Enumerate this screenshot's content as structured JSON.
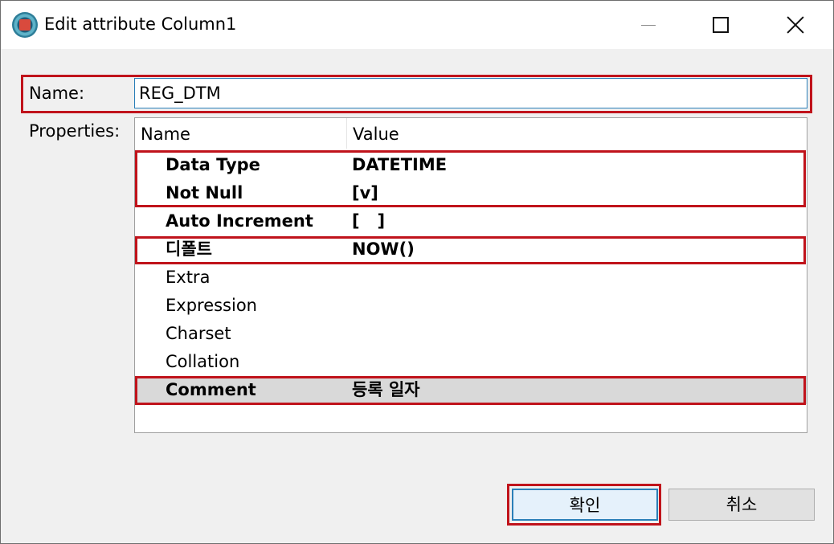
{
  "window": {
    "title": "Edit attribute Column1"
  },
  "form": {
    "name_label": "Name:",
    "name_value": "REG_DTM",
    "properties_label": "Properties:"
  },
  "table": {
    "headers": [
      "Name",
      "Value"
    ],
    "rows": [
      {
        "name": "Data Type",
        "value": "DATETIME"
      },
      {
        "name": "Not Null",
        "value": "[v]"
      },
      {
        "name": "Auto Increment",
        "value": "[   ]"
      },
      {
        "name": "디폴트",
        "value": "NOW()"
      },
      {
        "name": "Extra",
        "value": ""
      },
      {
        "name": "Expression",
        "value": ""
      },
      {
        "name": "Charset",
        "value": ""
      },
      {
        "name": "Collation",
        "value": ""
      },
      {
        "name": "Comment",
        "value": "등록 일자"
      }
    ]
  },
  "buttons": {
    "ok_label": "확인",
    "cancel_label": "취소"
  },
  "colors": {
    "highlight": "#c0131b",
    "focus": "#2a7fb8",
    "selected_row": "#d9d9d9"
  }
}
